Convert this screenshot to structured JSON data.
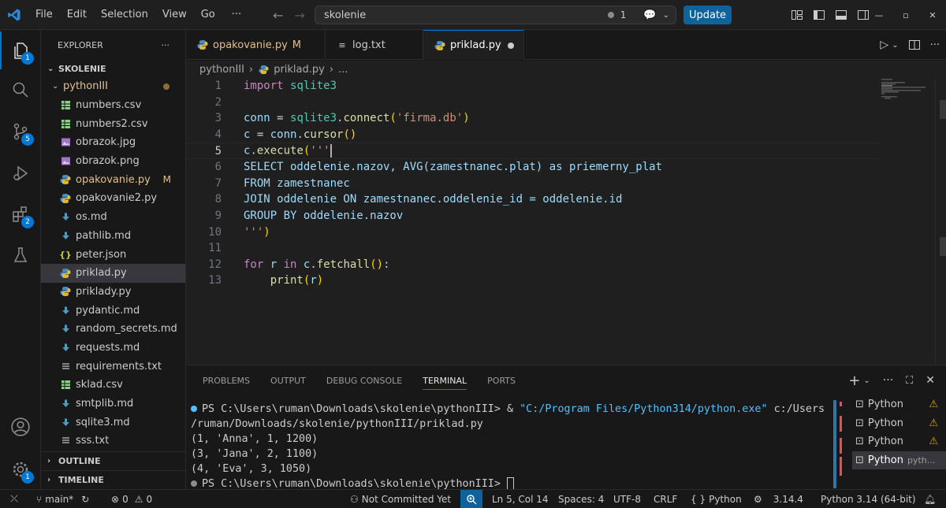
{
  "titlebar": {
    "menu": [
      "File",
      "Edit",
      "Selection",
      "View",
      "Go"
    ],
    "more": "···",
    "search_text": "skolenie",
    "notifications_count": "1",
    "update_label": "Update"
  },
  "activity": {
    "badges": {
      "explorer": "1",
      "scm": "5",
      "extensions": "2",
      "accounts": "1"
    }
  },
  "sidebar": {
    "title": "EXPLORER",
    "more": "···",
    "root": "SKOLENIE",
    "folder": "pythonIII",
    "files": [
      {
        "name": "numbers.csv",
        "icon": "csv"
      },
      {
        "name": "numbers2.csv",
        "icon": "csv"
      },
      {
        "name": "obrazok.jpg",
        "icon": "image"
      },
      {
        "name": "obrazok.png",
        "icon": "image"
      },
      {
        "name": "opakovanie.py",
        "icon": "python",
        "badge": "M"
      },
      {
        "name": "opakovanie2.py",
        "icon": "python"
      },
      {
        "name": "os.md",
        "icon": "markdown"
      },
      {
        "name": "pathlib.md",
        "icon": "markdown"
      },
      {
        "name": "peter.json",
        "icon": "json"
      },
      {
        "name": "priklad.py",
        "icon": "python"
      },
      {
        "name": "priklady.py",
        "icon": "python"
      },
      {
        "name": "pydantic.md",
        "icon": "markdown"
      },
      {
        "name": "random_secrets.md",
        "icon": "markdown"
      },
      {
        "name": "requests.md",
        "icon": "markdown"
      },
      {
        "name": "requirements.txt",
        "icon": "text"
      },
      {
        "name": "sklad.csv",
        "icon": "csv"
      },
      {
        "name": "smtplib.md",
        "icon": "markdown"
      },
      {
        "name": "sqlite3.md",
        "icon": "markdown"
      },
      {
        "name": "sss.txt",
        "icon": "text"
      }
    ],
    "outline": "OUTLINE",
    "timeline": "TIMELINE"
  },
  "tabs": [
    {
      "label": "opakovanie.py",
      "badge": "M"
    },
    {
      "label": "log.txt"
    },
    {
      "label": "priklad.py"
    }
  ],
  "breadcrumb": {
    "folder": "pythonIII",
    "file": "priklad.py",
    "more": "..."
  },
  "editor": {
    "line_numbers": [
      "1",
      "2",
      "3",
      "4",
      "5",
      "6",
      "7",
      "8",
      "9",
      "10",
      "11",
      "12",
      "13"
    ],
    "current_line": 5,
    "code": {
      "l1_kw": "import",
      "l1_mod": "sqlite3",
      "l3_var": "conn",
      "l3_eq": " = ",
      "l3_mod": "sqlite3",
      "l3_dot": ".",
      "l3_fn": "connect",
      "l3_p1": "(",
      "l3_str": "'firma.db'",
      "l3_p2": ")",
      "l4_var": "c",
      "l4_eq": " = ",
      "l4_var2": "conn",
      "l4_dot": ".",
      "l4_fn": "cursor",
      "l4_p": "()",
      "l5_var": "c",
      "l5_dot": ".",
      "l5_fn": "execute",
      "l5_p": "(",
      "l5_str": "'''",
      "l6": "SELECT oddelenie.nazov, AVG(zamestnanec.plat) as priemerny_plat",
      "l7": "FROM zamestnanec",
      "l8": "JOIN oddelenie ON zamestnanec.oddelenie_id = oddelenie.id",
      "l9": "GROUP BY oddelenie.nazov",
      "l10_str": "'''",
      "l10_p": ")",
      "l12_kw": "for",
      "l12_var": "r",
      "l12_in": "in",
      "l12_var2": "c",
      "l12_dot": ".",
      "l12_fn": "fetchall",
      "l12_p": "()",
      "l12_colon": ":",
      "l13_fn": "print",
      "l13_p1": "(",
      "l13_var": "r",
      "l13_p2": ")"
    }
  },
  "panel": {
    "tabs": [
      "PROBLEMS",
      "OUTPUT",
      "DEBUG CONSOLE",
      "TERMINAL",
      "PORTS"
    ],
    "active_tab": "TERMINAL",
    "terminal": {
      "prompt1": "PS C:\\Users\\ruman\\Downloads\\skolenie\\pythonIII> & ",
      "exe": "\"C:/Program Files/Python314/python.exe\"",
      "arg1": " c:/Users",
      "arg2": "/ruman/Downloads/skolenie/pythonIII/priklad.py",
      "out": [
        "(1, 'Anna', 1, 1200)",
        "(3, 'Jana', 2, 1100)",
        "(4, 'Eva', 3, 1050)"
      ],
      "prompt2": "PS C:\\Users\\ruman\\Downloads\\skolenie\\pythonIII> "
    },
    "terminal_list": [
      {
        "label": "Python",
        "warn": true
      },
      {
        "label": "Python",
        "warn": true
      },
      {
        "label": "Python",
        "warn": true
      },
      {
        "label": "Python",
        "extra": "pyth..."
      }
    ]
  },
  "status": {
    "branch": "main*",
    "errors": "0",
    "warnings": "0",
    "not_committed": "Not Committed Yet",
    "position": "Ln 5, Col 14",
    "spaces": "Spaces: 4",
    "encoding": "UTF-8",
    "eol": "CRLF",
    "language": "Python",
    "python_version": "3.14.4",
    "interpreter": "Python 3.14 (64-bit)"
  },
  "colors": {
    "accent": "#0078d4",
    "update_button": "#0e639c",
    "modified": "#e2c08d",
    "warning": "#cca700"
  }
}
